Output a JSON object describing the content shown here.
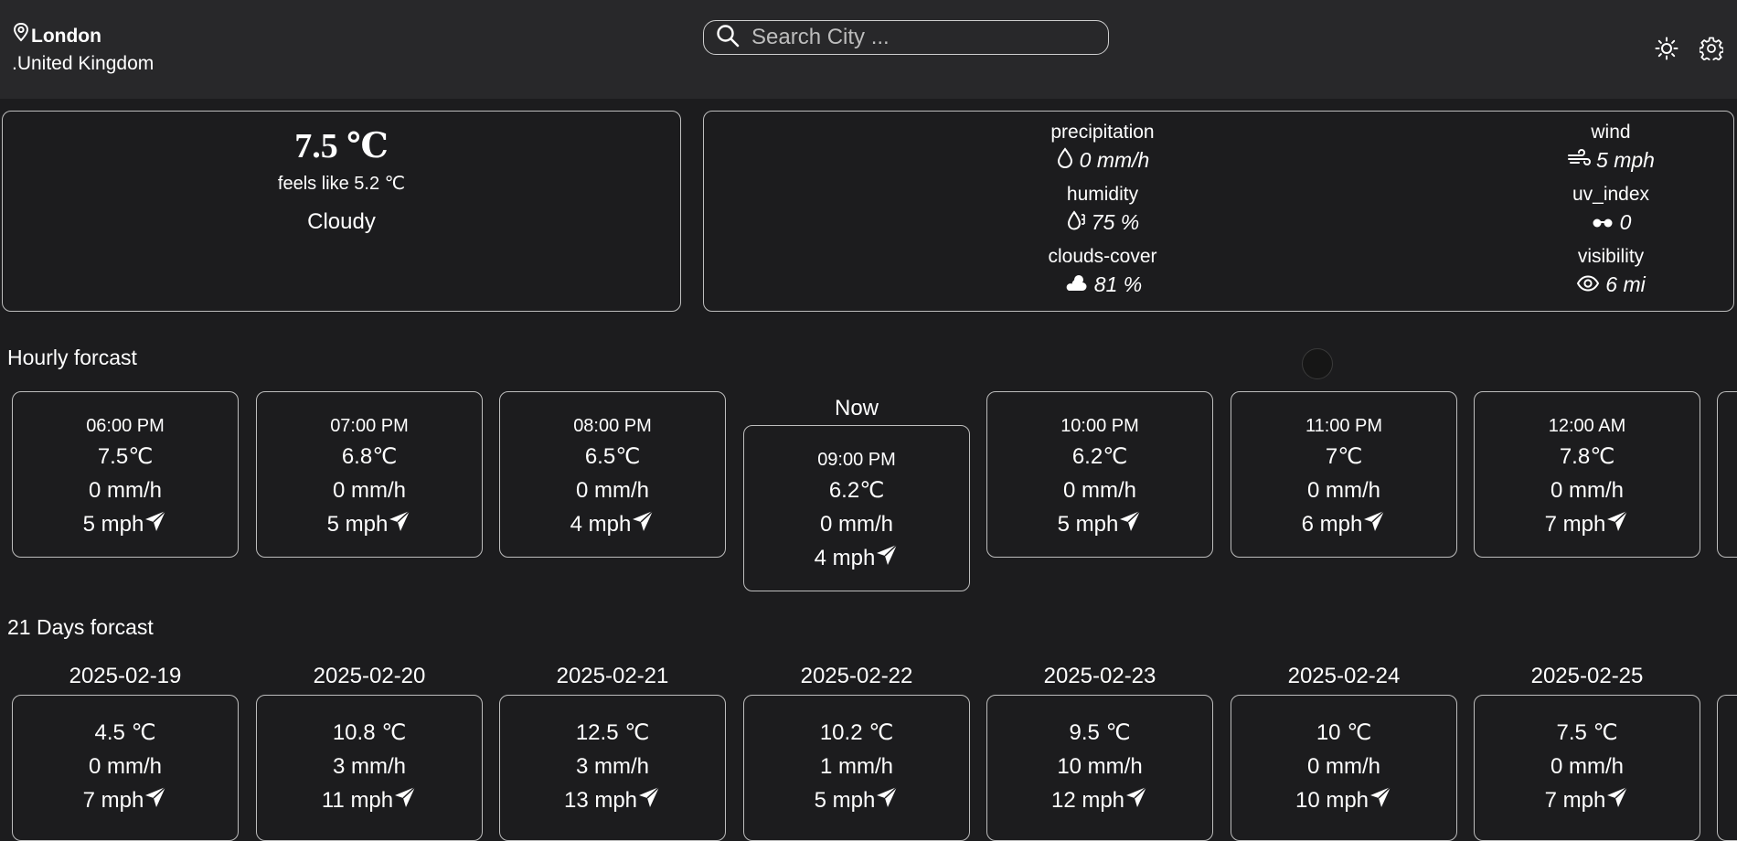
{
  "location": {
    "city": "London",
    "country": ".United Kingdom"
  },
  "search": {
    "placeholder": "Search City ..."
  },
  "current": {
    "temp": "7.5 ℃",
    "feels_like": "feels like 5.2 ℃",
    "condition": "Cloudy"
  },
  "stats": {
    "precipitation": {
      "label": "precipitation",
      "value": "0 mm/h"
    },
    "wind": {
      "label": "wind",
      "value": "5 mph"
    },
    "humidity": {
      "label": "humidity",
      "value": "75 %"
    },
    "uv_index": {
      "label": "uv_index",
      "value": "0"
    },
    "clouds": {
      "label": "clouds-cover",
      "value": "81 %"
    },
    "visibility": {
      "label": "visibility",
      "value": "6 mi"
    }
  },
  "hourly": {
    "title": "Hourly forcast",
    "now_label": "Now",
    "items": [
      {
        "time": "06:00 PM",
        "temp": "7.5℃",
        "precip": "0 mm/h",
        "wind": "5 mph"
      },
      {
        "time": "07:00 PM",
        "temp": "6.8℃",
        "precip": "0 mm/h",
        "wind": "5 mph"
      },
      {
        "time": "08:00 PM",
        "temp": "6.5℃",
        "precip": "0 mm/h",
        "wind": "4 mph"
      },
      {
        "time": "09:00 PM",
        "temp": "6.2℃",
        "precip": "0 mm/h",
        "wind": "4 mph"
      },
      {
        "time": "10:00 PM",
        "temp": "6.2℃",
        "precip": "0 mm/h",
        "wind": "5 mph"
      },
      {
        "time": "11:00 PM",
        "temp": "7℃",
        "precip": "0 mm/h",
        "wind": "6 mph"
      },
      {
        "time": "12:00 AM",
        "temp": "7.8℃",
        "precip": "0 mm/h",
        "wind": "7 mph"
      }
    ]
  },
  "daily": {
    "title": "21 Days forcast",
    "items": [
      {
        "date": "2025-02-19",
        "temp": "4.5 ℃",
        "precip": "0 mm/h",
        "wind": "7 mph"
      },
      {
        "date": "2025-02-20",
        "temp": "10.8 ℃",
        "precip": "3 mm/h",
        "wind": "11 mph"
      },
      {
        "date": "2025-02-21",
        "temp": "12.5 ℃",
        "precip": "3 mm/h",
        "wind": "13 mph"
      },
      {
        "date": "2025-02-22",
        "temp": "10.2 ℃",
        "precip": "1 mm/h",
        "wind": "5 mph"
      },
      {
        "date": "2025-02-23",
        "temp": "9.5 ℃",
        "precip": "10 mm/h",
        "wind": "12 mph"
      },
      {
        "date": "2025-02-24",
        "temp": "10 ℃",
        "precip": "0 mm/h",
        "wind": "10 mph"
      },
      {
        "date": "2025-02-25",
        "temp": "7.5 ℃",
        "precip": "0 mm/h",
        "wind": "7 mph"
      }
    ]
  },
  "icons": {
    "location": "map-pin-icon",
    "search": "search-icon",
    "theme": "sun-icon",
    "settings": "gear-icon",
    "wind_direction": "paper-plane-icon"
  }
}
